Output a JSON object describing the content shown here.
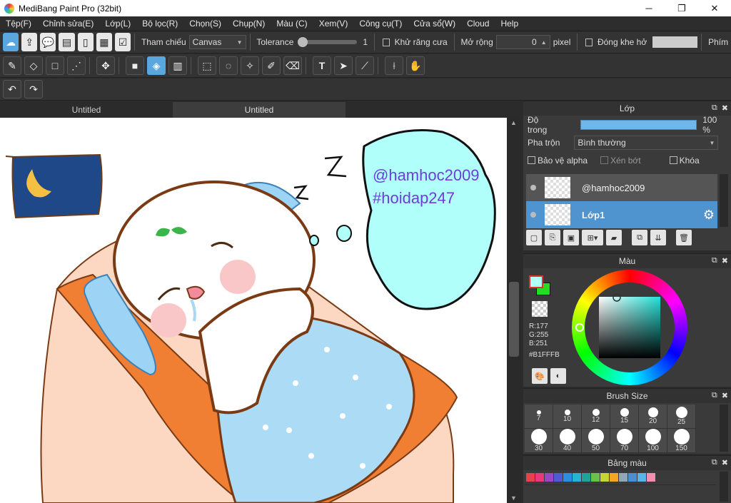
{
  "window": {
    "title": "MediBang Paint Pro (32bit)",
    "minimize": "─",
    "maximize": "❐",
    "close": "✕"
  },
  "menu": [
    "Tệp(F)",
    "Chỉnh sửa(E)",
    "Lớp(L)",
    "Bộ lọc(R)",
    "Chọn(S)",
    "Chụp(N)",
    "Màu (C)",
    "Xem(V)",
    "Công cụ(T)",
    "Cửa sổ(W)",
    "Cloud",
    "Help"
  ],
  "toolbar1": {
    "reference_label": "Tham chiếu",
    "reference_value": "Canvas",
    "tolerance_label": "Tolerance",
    "tolerance_value": "1",
    "antialias_label": "Khử răng cưa",
    "expand_label": "Mở rộng",
    "expand_value": "0",
    "pixel_label": "pixel",
    "close_gap_label": "Đóng khe hở",
    "shortcut_label": "Phím"
  },
  "tabs": [
    "Untitled",
    "Untitled"
  ],
  "canvas": {
    "bubble_line1": "@hamhoc2009",
    "bubble_line2": "#hoidap247",
    "zzz": "Z Z"
  },
  "layers_panel": {
    "title": "Lớp",
    "opacity_label": "Độ trong",
    "opacity_value": "100 %",
    "blend_label": "Pha trộn",
    "blend_value": "Bình thường",
    "protect_alpha": "Bảo vệ alpha",
    "clipping": "Xén bớt",
    "lock": "Khóa",
    "layers": [
      {
        "name": "@hamhoc2009"
      },
      {
        "name": "Lớp1"
      }
    ]
  },
  "color_panel": {
    "title": "Màu",
    "r": "R:177",
    "g": "G:255",
    "b": "B:251",
    "hex": "#B1FFFB",
    "primary_color": "#B1FFFB",
    "secondary_color": "#22DD22"
  },
  "brush_panel": {
    "title": "Brush Size",
    "sizes_row1": [
      "7",
      "10",
      "12",
      "15",
      "20",
      "25"
    ],
    "sizes_row2": [
      "30",
      "40",
      "50",
      "70",
      "100",
      "150"
    ]
  },
  "palette_panel": {
    "title": "Bảng màu",
    "colors": [
      "#e8414d",
      "#e83a7a",
      "#9b46c4",
      "#4f5bd5",
      "#2d8de0",
      "#23b5d3",
      "#1fa39b",
      "#6cc04a",
      "#c6d630",
      "#f5a623",
      "#8fa8b8",
      "#4b8fd0",
      "#5bb4e8",
      "#f48fb1"
    ]
  }
}
